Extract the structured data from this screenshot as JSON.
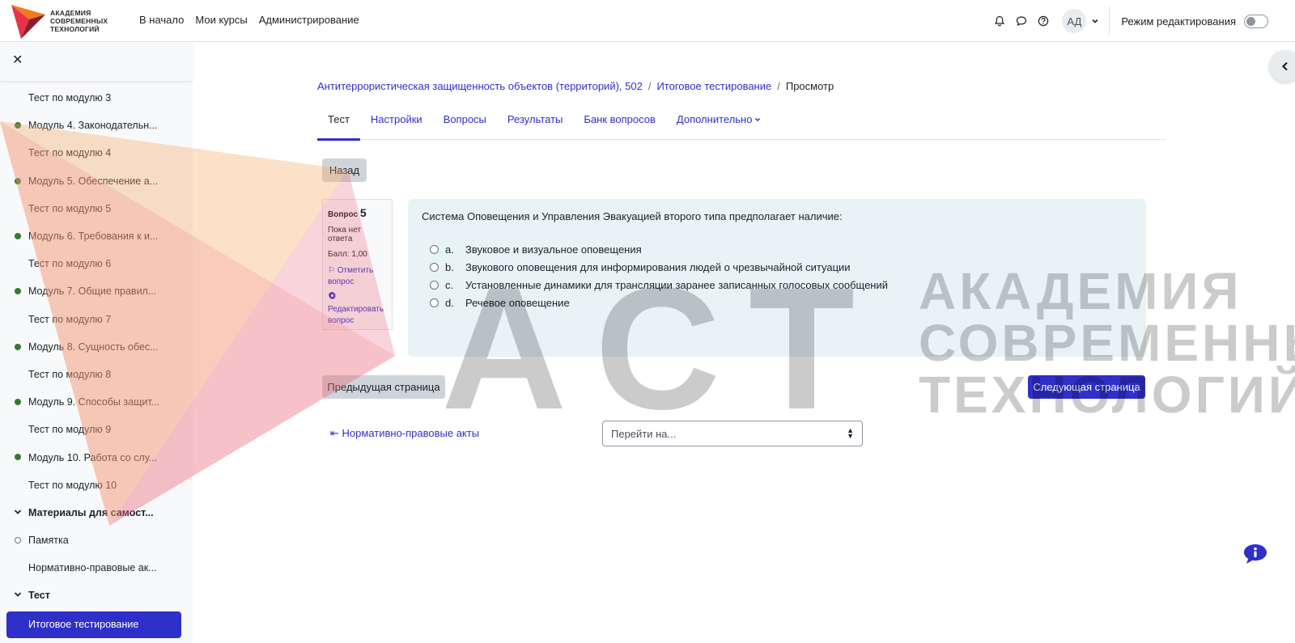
{
  "brand": {
    "line1": "АКАДЕМИЯ",
    "line2": "СОВРЕМЕННЫХ",
    "line3": "ТЕХНОЛОГИЙ"
  },
  "nav": {
    "home": "В начало",
    "my_courses": "Мои курсы",
    "admin": "Администрирование",
    "avatar_initials": "АД",
    "edit_mode_label": "Режим редактирования",
    "edit_mode_on": false
  },
  "sidebar": {
    "items": [
      {
        "label": "Тест по модулю 3",
        "marker": "none"
      },
      {
        "label": "Модуль 4. Законодательн...",
        "marker": "filled"
      },
      {
        "label": "Тест по модулю 4",
        "marker": "none"
      },
      {
        "label": "Модуль 5. Обеспечение а...",
        "marker": "filled"
      },
      {
        "label": "Тест по модулю 5",
        "marker": "none"
      },
      {
        "label": "Модуль 6. Требования к и...",
        "marker": "filled"
      },
      {
        "label": "Тест по модулю 6",
        "marker": "none"
      },
      {
        "label": "Модуль 7. Общие правил...",
        "marker": "filled"
      },
      {
        "label": "Тест по модулю 7",
        "marker": "none"
      },
      {
        "label": "Модуль 8. Сущность обес...",
        "marker": "filled"
      },
      {
        "label": "Тест по модулю 8",
        "marker": "none"
      },
      {
        "label": "Модуль 9. Способы защит...",
        "marker": "filled"
      },
      {
        "label": "Тест по модулю 9",
        "marker": "none"
      },
      {
        "label": "Модуль 10. Работа со слу...",
        "marker": "filled"
      },
      {
        "label": "Тест по модулю 10",
        "marker": "none"
      },
      {
        "label": "Материалы для самост...",
        "marker": "section"
      },
      {
        "label": "Памятка",
        "marker": "empty"
      },
      {
        "label": "Нормативно-правовые ак...",
        "marker": "none"
      },
      {
        "label": "Тест",
        "marker": "section"
      },
      {
        "label": "Итоговое тестирование",
        "marker": "active"
      }
    ]
  },
  "breadcrumb": {
    "course": "Антитеррористическая защищенность объектов (территорий), 502",
    "quiz": "Итоговое тестирование",
    "current": "Просмотр"
  },
  "tabs": {
    "test": "Тест",
    "settings": "Настройки",
    "questions": "Вопросы",
    "results": "Результаты",
    "bank": "Банк вопросов",
    "more": "Дополнительно"
  },
  "buttons": {
    "back": "Назад",
    "prev": "Предыдущая страница",
    "next": "Следующая страница"
  },
  "question_info": {
    "label": "Вопрос",
    "number": "5",
    "state": "Пока нет ответа",
    "grade": "Балл: 1,00",
    "flag": "Отметить вопрос",
    "edit": "Редактировать вопрос"
  },
  "question": {
    "text": "Система Оповещения и Управления Эвакуацией второго типа предполагает наличие:",
    "answers": [
      {
        "letter": "a.",
        "text": "Звуковое и визуальное оповещения"
      },
      {
        "letter": "b.",
        "text": "Звукового оповещения для информирования людей о чрезвычайной ситуации"
      },
      {
        "letter": "c.",
        "text": "Установленные динамики для трансляции заранее записанных голосовых сообщений"
      },
      {
        "letter": "d.",
        "text": "Речевое оповещение"
      }
    ]
  },
  "footer": {
    "prev_activity": "Нормативно-правовые акты",
    "jump_placeholder": "Перейти на..."
  },
  "watermark": {
    "big": "АСТ",
    "line1": "АКАДЕМИЯ",
    "line2": "СОВРЕМЕННЫХ",
    "line3": "ТЕХНОЛОГИЙ"
  },
  "colors": {
    "primary": "#2f2fc9",
    "complete_dot": "#357a32",
    "question_bg": "#e7f3f5"
  }
}
